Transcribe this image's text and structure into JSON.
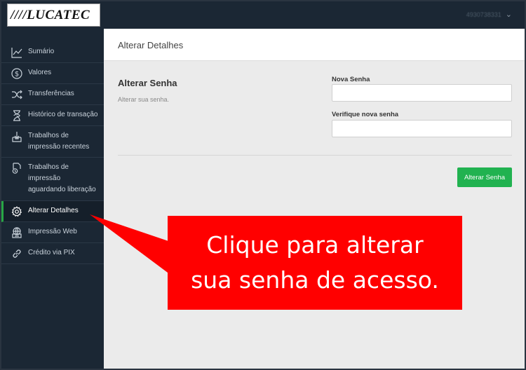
{
  "app": {
    "logo_text": "////LUCATEC",
    "user_name": "4930738331"
  },
  "sidebar": {
    "items": [
      {
        "label": "Sumário",
        "icon": "chart-line-icon"
      },
      {
        "label": "Valores",
        "icon": "dollar-circle-icon"
      },
      {
        "label": "Transferências",
        "icon": "shuffle-icon"
      },
      {
        "label": "Histórico de transação",
        "icon": "hourglass-icon"
      },
      {
        "label": "Trabalhos de impressão recentes",
        "icon": "inbox-download-icon"
      },
      {
        "label": "Trabalhos de impressão aguardando liberação",
        "icon": "document-clock-icon"
      },
      {
        "label": "Alterar Detalhes",
        "icon": "gear-icon",
        "active": true
      },
      {
        "label": "Impressão Web",
        "icon": "printer-web-icon"
      },
      {
        "label": "Crédito via PIX",
        "icon": "link-icon"
      }
    ]
  },
  "main": {
    "page_title": "Alterar Detalhes",
    "section_title": "Alterar Senha",
    "section_description": "Alterar sua senha.",
    "new_password_label": "Nova Senha",
    "new_password_value": "",
    "confirm_password_label": "Verifique nova senha",
    "confirm_password_value": "",
    "submit_label": "Alterar Senha"
  },
  "callout": {
    "line1": "Clique para alterar",
    "line2": "sua senha de acesso.",
    "color": "#ff0000"
  },
  "colors": {
    "sidebar_bg": "#1b2734",
    "accent_green": "#21b250",
    "content_bg": "#ebebeb"
  }
}
